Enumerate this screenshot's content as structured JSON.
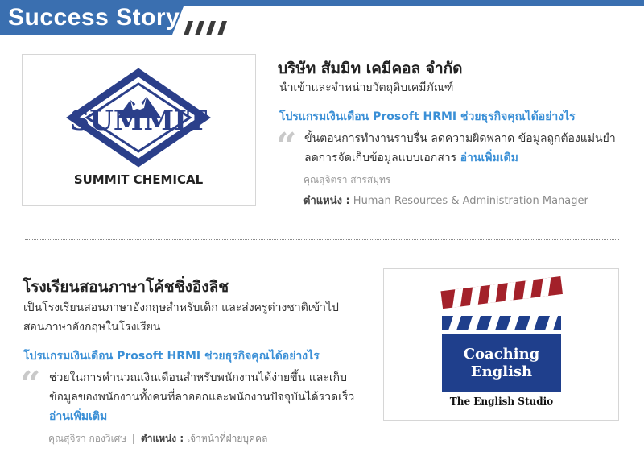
{
  "header": {
    "title": "Success Story",
    "accent_color": "#3a6fb0"
  },
  "stories": [
    {
      "logo": {
        "text": "SUMMIT CHEMICAL",
        "mark_text": "SUMMIT",
        "name": "summit-chemical-logo"
      },
      "company": "บริษัท สัมมิท เคมีคอล จำกัด",
      "description": "นำเข้าและจำหน่ายวัตถุดิบเคมีภัณฑ์",
      "program": "โปรแกรมเงินเดือน Prosoft HRMI ช่วยธุรกิจคุณได้อย่างไร",
      "quote_line1": "ขั้นตอนการทำงานราบรื่น ลดความผิดพลาด ข้อมูลถูกต้องแม่นยำ",
      "quote_line2": "ลดการจัดเก็บข้อมูลแบบเอกสาร",
      "read_more": "อ่านเพิ่มเติม",
      "person_name": "คุณสุจิตรา  สารสมุทร",
      "position_label": "ตำแหน่ง :",
      "position_value": "Human Resources & Administration Manager"
    },
    {
      "logo": {
        "title_line1": "Coaching",
        "title_line2": "English",
        "subtitle": "The English Studio",
        "name": "coaching-english-logo"
      },
      "company": "โรงเรียนสอนภาษาโค้ชชิ่งอิงลิช",
      "description_line1": "เป็นโรงเรียนสอนภาษาอังกฤษสำหรับเด็ก และส่งครูต่างชาติเข้าไป",
      "description_line2": "สอนภาษาอังกฤษในโรงเรียน",
      "program": "โปรแกรมเงินเดือน Prosoft HRMI ช่วยธุรกิจคุณได้อย่างไร",
      "quote_line1": "ช่วยในการคำนวณเงินเดือนสำหรับพนักงานได้ง่ายขึ้น และเก็บ",
      "quote_line2": "ข้อมูลของพนักงานทั้งคนที่ลาออกและพนักงานปัจจุบันได้รวดเร็ว",
      "read_more": "อ่านเพิ่มเติม",
      "person_name": "คุณสุจิรา กองวิเศษ",
      "separator": "|",
      "position_label": "ตำแหน่ง :",
      "position_value": "เจ้าหน้าที่ฝ่ายบุคคล"
    }
  ],
  "quote_mark": "“",
  "colors": {
    "link": "#3a8fd6",
    "summit_blue": "#2b3f8a",
    "clapper_red": "#a3212a",
    "clapper_blue": "#1f3f8c"
  }
}
